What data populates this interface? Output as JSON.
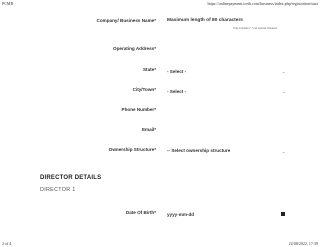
{
  "print": {
    "header_left": "PCMB",
    "header_right": "https://onlinepayment.tcetb.com/business/index.php/registration/start",
    "footer_left": "2 of 4",
    "footer_right": "22/08/2022, 17:39"
  },
  "form": {
    "company_name": {
      "label": "Company/ Business Name*",
      "placeholder": "Maximum length of 80 characters",
      "hint": "Only includes (*,*) as special character"
    },
    "operating_address": {
      "label": "Operating Address*"
    },
    "state": {
      "label": "State*",
      "value": "- Select -"
    },
    "city": {
      "label": "City/Town*",
      "value": "- Select -"
    },
    "phone": {
      "label": "Phone Number*"
    },
    "email": {
      "label": "Email*"
    },
    "ownership": {
      "label": "Ownership Structure*",
      "value": "-- Select ownership structure"
    }
  },
  "director": {
    "section_title": "DIRECTOR DETAILS",
    "subtitle": "DIRECTOR 1",
    "dob": {
      "label": "Date Of Birth*",
      "placeholder": "yyyy-mm-dd"
    }
  },
  "icons": {
    "select_arrow": "chevron-down-icon",
    "calendar": "calendar-icon"
  }
}
